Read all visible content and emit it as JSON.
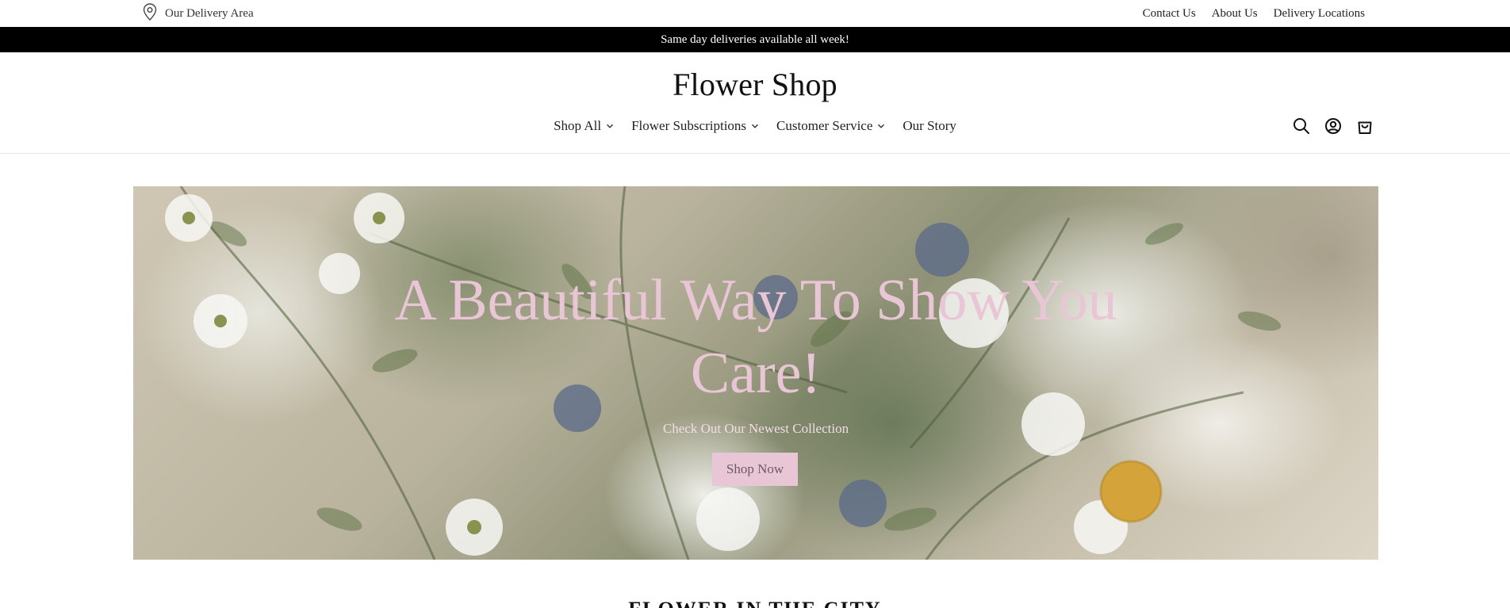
{
  "utility_bar": {
    "delivery_label": "Our Delivery Area",
    "links": [
      "Contact Us",
      "About Us",
      "Delivery Locations"
    ]
  },
  "announcement": {
    "text": "Same day deliveries available all week!"
  },
  "header": {
    "logo": "Flower Shop",
    "nav": [
      {
        "label": "Shop All",
        "has_dropdown": true
      },
      {
        "label": "Flower Subscriptions",
        "has_dropdown": true
      },
      {
        "label": "Customer Service",
        "has_dropdown": true
      },
      {
        "label": "Our Story",
        "has_dropdown": false
      }
    ],
    "icons": [
      "search-icon",
      "account-icon",
      "cart-icon"
    ]
  },
  "hero": {
    "title_line1": "A Beautiful Way To Show You",
    "title_line2": "Care!",
    "subtitle": "Check Out Our Newest Collection",
    "button": "Shop Now"
  },
  "colors": {
    "accent_pink": "#e9c6d5",
    "announcement_bg": "#000000"
  },
  "section": {
    "heading": "FLOWER IN THE CITY"
  }
}
